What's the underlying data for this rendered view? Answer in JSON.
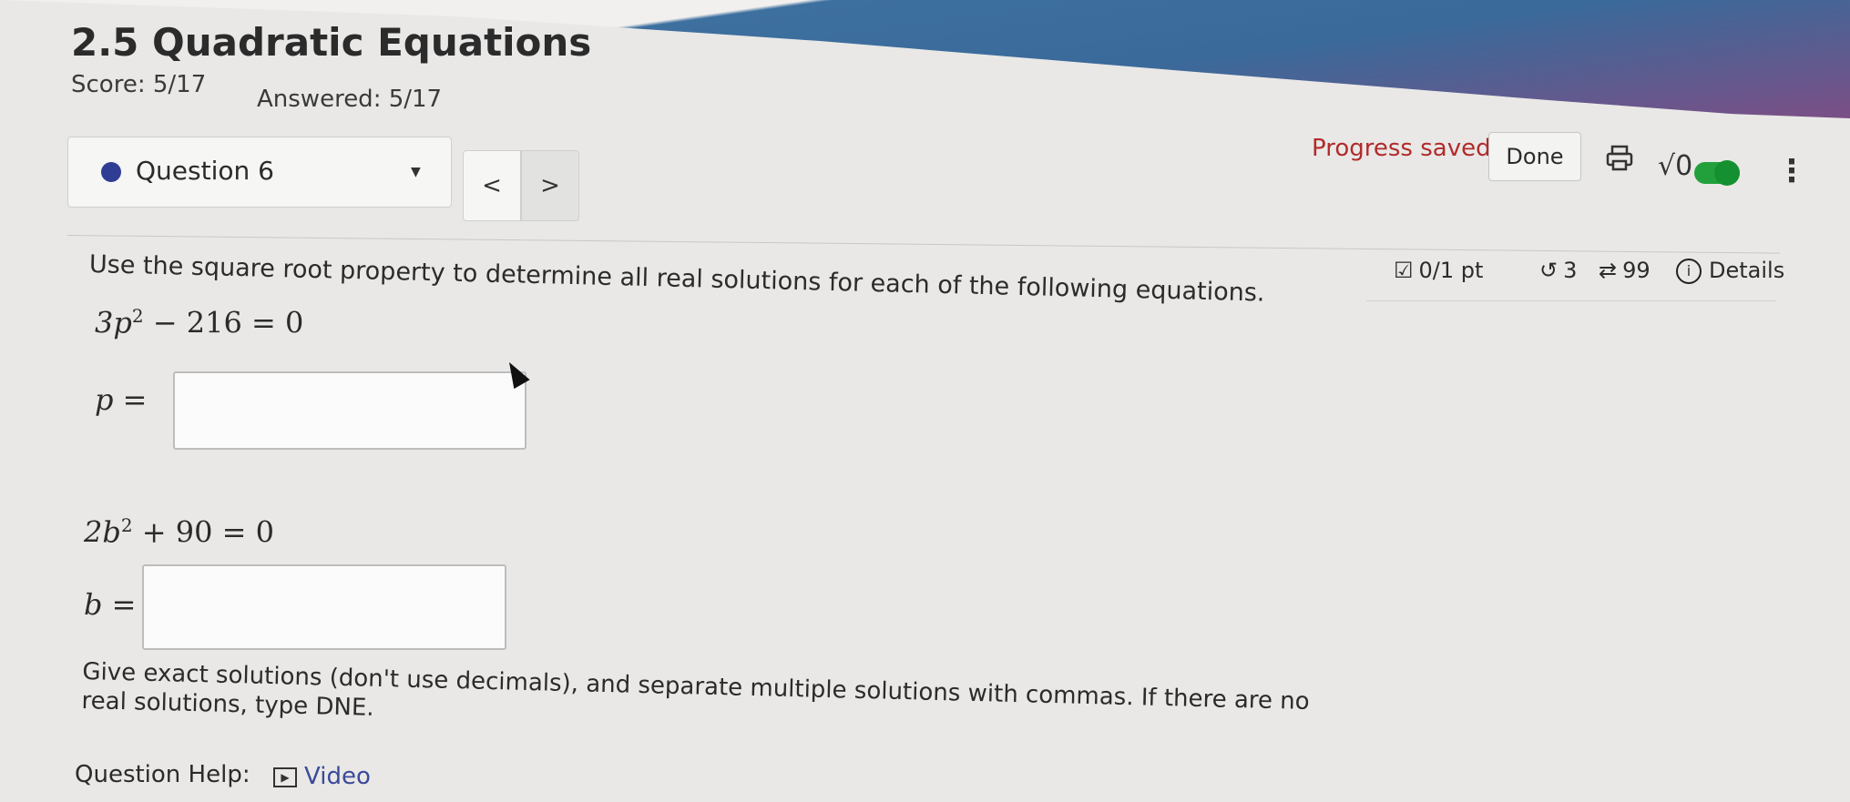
{
  "header": {
    "title": "2.5 Quadratic Equations",
    "score": "Score: 5/17",
    "answered": "Answered: 5/17"
  },
  "question_nav": {
    "selected": "Question 6",
    "prev": "<",
    "next": ">"
  },
  "status": {
    "progress_saved": "Progress saved",
    "done_label": "Done"
  },
  "toolbar_icons": [
    "print-icon",
    "sqrt-icon",
    "toggle-switch",
    "more-vertical-icon"
  ],
  "meta": {
    "points": "0/1 pt",
    "retries": "3",
    "attempts": "99",
    "details": "Details"
  },
  "question": {
    "prompt": "Use the square root property to determine all real solutions for each of the following equations.",
    "parts": [
      {
        "eq_left": "3p",
        "eq_exp": "2",
        "eq_right": " − 216 = 0",
        "answer_label": "p =",
        "answer_value": ""
      },
      {
        "eq_left": "2b",
        "eq_exp": "2",
        "eq_right": " + 90 = 0",
        "answer_label": "b =",
        "answer_value": ""
      }
    ],
    "instructions": "Give exact solutions (don't use decimals), and separate multiple solutions with commas. If there are no real solutions, type DNE."
  },
  "help": {
    "label": "Question Help:",
    "video": "Video"
  },
  "colors": {
    "accent_blue": "#3d6f9f",
    "progress_red": "#b12b2b",
    "toggle_green": "#22a03c",
    "question_dot": "#2f3e94",
    "link": "#3b4a9a"
  }
}
